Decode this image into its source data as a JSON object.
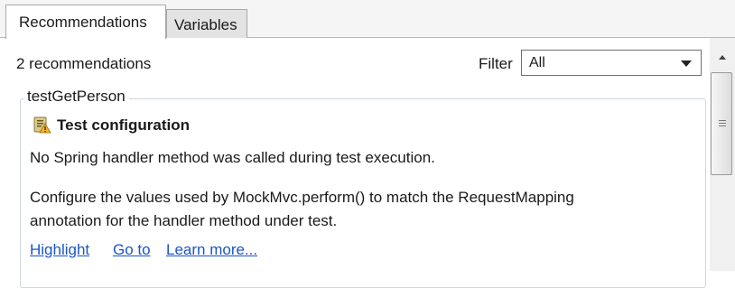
{
  "tabs": [
    {
      "label": "Recommendations",
      "active": true
    },
    {
      "label": "Variables",
      "active": false
    }
  ],
  "toolbar": {
    "count_label": "2 recommendations",
    "filter_label": "Filter",
    "filter_value": "All"
  },
  "group": {
    "title": "testGetPerson",
    "recommendation": {
      "icon": "test-config-warning-icon",
      "title": "Test configuration",
      "lines": [
        "No Spring handler method was called during test execution.",
        "Configure the values used by MockMvc.perform() to match the RequestMapping",
        "annotation for the handler method under test."
      ],
      "links": [
        "Highlight",
        "Go to",
        "Learn more..."
      ]
    }
  },
  "colors": {
    "link": "#1a55c9",
    "group_border": "#cfd6dd",
    "tab_inactive_bg": "#e3e3e3"
  }
}
